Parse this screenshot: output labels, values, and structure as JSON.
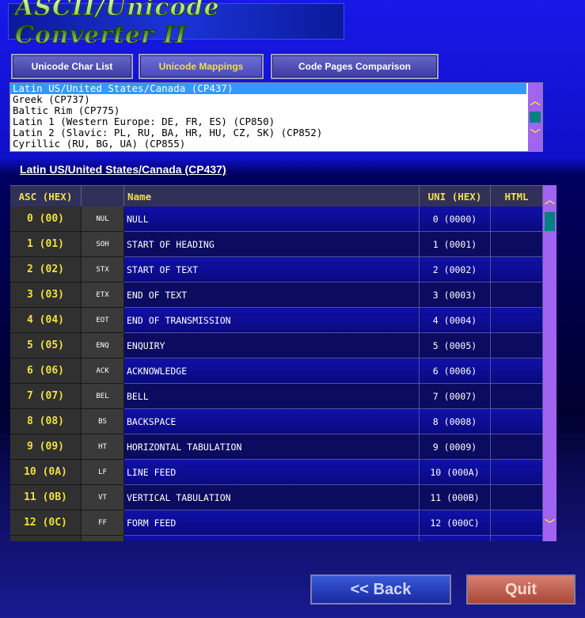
{
  "app": {
    "logo_text": "ASCII/Unicode Converter II"
  },
  "tabs": [
    {
      "label": "Unicode Char List",
      "active": false
    },
    {
      "label": "Unicode Mappings",
      "active": true
    },
    {
      "label": "Code Pages Comparison",
      "active": false
    }
  ],
  "code_pages": [
    "Latin US/United States/Canada (CP437)",
    "Greek (CP737)",
    "Baltic Rim (CP775)",
    "Latin 1 (Western Europe: DE, FR, ES) (CP850)",
    "Latin 2 (Slavic: PL, RU, BA, HR, HU, CZ, SK) (CP852)",
    "Cyrillic (RU, BG, UA) (CP855)"
  ],
  "selected_code_page": "Latin US/United States/Canada (CP437)",
  "table": {
    "headers": {
      "asc": "ASC (HEX)",
      "glyph": "",
      "name": "Name",
      "uni": "UNI (HEX)",
      "html": "HTML"
    },
    "rows": [
      {
        "asc": "0 (00)",
        "glyph": "NUL",
        "name": "NULL",
        "uni": "0 (0000)",
        "html": ""
      },
      {
        "asc": "1 (01)",
        "glyph": "SOH",
        "name": "START OF HEADING",
        "uni": "1 (0001)",
        "html": ""
      },
      {
        "asc": "2 (02)",
        "glyph": "STX",
        "name": "START OF TEXT",
        "uni": "2 (0002)",
        "html": ""
      },
      {
        "asc": "3 (03)",
        "glyph": "ETX",
        "name": "END OF TEXT",
        "uni": "3 (0003)",
        "html": ""
      },
      {
        "asc": "4 (04)",
        "glyph": "EOT",
        "name": "END OF TRANSMISSION",
        "uni": "4 (0004)",
        "html": ""
      },
      {
        "asc": "5 (05)",
        "glyph": "ENQ",
        "name": "ENQUIRY",
        "uni": "5 (0005)",
        "html": ""
      },
      {
        "asc": "6 (06)",
        "glyph": "ACK",
        "name": "ACKNOWLEDGE",
        "uni": "6 (0006)",
        "html": ""
      },
      {
        "asc": "7 (07)",
        "glyph": "BEL",
        "name": "BELL",
        "uni": "7 (0007)",
        "html": ""
      },
      {
        "asc": "8 (08)",
        "glyph": "BS",
        "name": "BACKSPACE",
        "uni": "8 (0008)",
        "html": ""
      },
      {
        "asc": "9 (09)",
        "glyph": "HT",
        "name": "HORIZONTAL TABULATION",
        "uni": "9 (0009)",
        "html": ""
      },
      {
        "asc": "10 (0A)",
        "glyph": "LF",
        "name": "LINE FEED",
        "uni": "10 (000A)",
        "html": ""
      },
      {
        "asc": "11 (0B)",
        "glyph": "VT",
        "name": "VERTICAL TABULATION",
        "uni": "11 (000B)",
        "html": ""
      },
      {
        "asc": "12 (0C)",
        "glyph": "FF",
        "name": "FORM FEED",
        "uni": "12 (000C)",
        "html": ""
      }
    ]
  },
  "buttons": {
    "back": "<< Back",
    "quit": "Quit"
  },
  "colors": {
    "accent": "#f0e040",
    "scrollbar": "#a064f0",
    "selection": "#3399ff"
  }
}
